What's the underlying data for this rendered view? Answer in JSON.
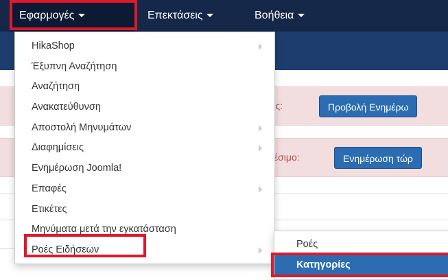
{
  "navbar": {
    "apps_label": "Εφαρμογές",
    "extensions_label": "Επεκτάσεις",
    "help_label": "Βοήθεια"
  },
  "alerts": {
    "alert1_text": "ιμες:",
    "alert1_button": "Προβολή Ενημέρω",
    "alert2_text": "αθέσιμο:",
    "alert2_button": "Ενημέρωση τώρ"
  },
  "dropdown": {
    "items": [
      {
        "label": "HikaShop",
        "has_submenu": true
      },
      {
        "label": "Έξυπνη Αναζήτηση",
        "has_submenu": false
      },
      {
        "label": "Αναζήτηση",
        "has_submenu": false
      },
      {
        "label": "Ανακατεύθυνση",
        "has_submenu": false
      },
      {
        "label": "Αποστολή Μηνυμάτων",
        "has_submenu": true
      },
      {
        "label": "Διαφημίσεις",
        "has_submenu": true
      },
      {
        "label": "Ενημέρωση Joomla!",
        "has_submenu": false
      },
      {
        "label": "Επαφές",
        "has_submenu": true
      },
      {
        "label": "Ετικέτες",
        "has_submenu": false
      },
      {
        "label": "Μηνύματα μετά την εγκατάσταση",
        "has_submenu": false
      },
      {
        "label": "Ροές Ειδήσεων",
        "has_submenu": true
      }
    ]
  },
  "submenu": {
    "items": [
      {
        "label": "Ροές"
      },
      {
        "label": "Κατηγορίες",
        "active": true
      }
    ]
  },
  "colors": {
    "navbar": "#15284a",
    "highlight": "#e0182a",
    "primary": "#2b6cb2",
    "alert_bg": "#f2dede"
  }
}
